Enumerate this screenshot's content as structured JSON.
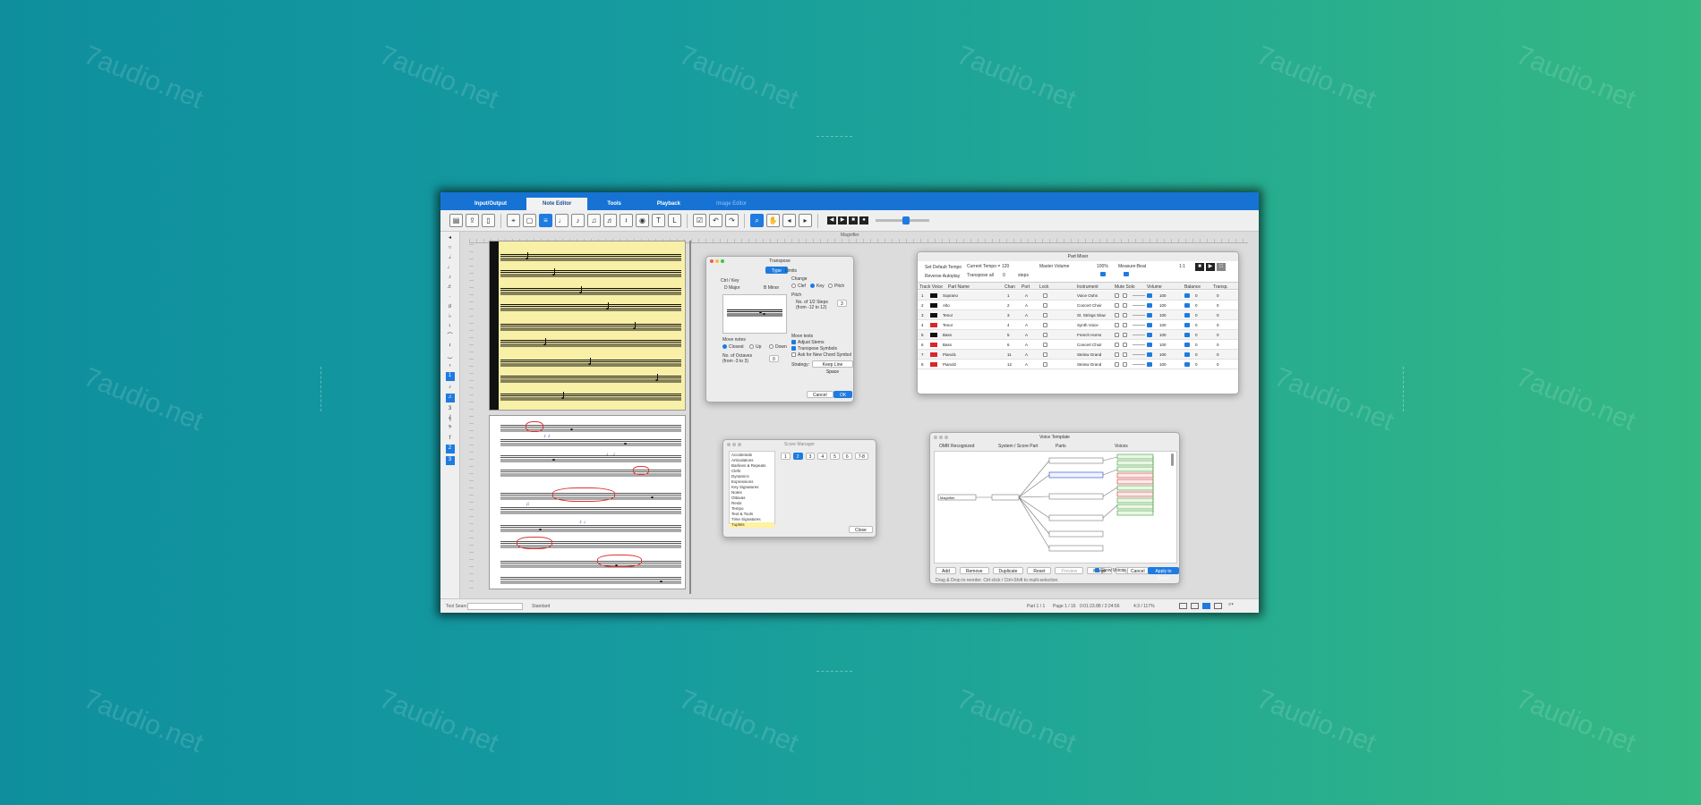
{
  "watermark": "7audio.net",
  "tabs": {
    "input_output": "Input/Output",
    "note_editor": "Note Editor",
    "tools": "Tools",
    "playback": "Playback",
    "image_editor": "Image Editor"
  },
  "workspace": {
    "magnifier_label": "Magnifier"
  },
  "transpose": {
    "title": "Transpose",
    "tab_type": "Type",
    "tab_limits": "Limits",
    "ctrl_key": "Ctrl / Key",
    "from_key": "D Major",
    "to_key": "B Minor",
    "change_label": "Change",
    "opt_clef": "Clef",
    "opt_key": "Key",
    "opt_pitch": "Pitch",
    "pitch_label": "Pitch",
    "steps_label": "No. of 1/2 Steps",
    "steps_range": "(from -12 to 12)",
    "steps_value": "3",
    "move_notes": "Move notes",
    "closest": "Closest",
    "up": "Up",
    "down": "Down",
    "octaves_label": "No. of Octaves",
    "octaves_range": "(from -3 to 3)",
    "octaves_value": "0",
    "more_texts": "Move texts",
    "adjust_stems": "Adjust Stems",
    "transpose_symbols": "Transpose Symbols",
    "ask_symbol": "Ask for New Chord Symbol",
    "strategy_label": "Strategy:",
    "strategy_value": "Keep Line Space",
    "cancel": "Cancel",
    "ok": "OK"
  },
  "mixer": {
    "title": "Part Mixer",
    "tempo_label": "Current Tempo =",
    "tempo_value": "120",
    "transpose_all": "Transpose all",
    "transpose_value": "0",
    "steps": "steps",
    "master_volume": "Master Volume",
    "master_value": "100%",
    "measure_beat": "Measure:Beat",
    "measure_value": "1:1",
    "set_tempo": "Set Default Tempo",
    "reverse_all": "Reverse Autoplay",
    "columns": [
      "Track Voice",
      "Part Name",
      "Chan",
      "Port",
      "Lock",
      "Instrument",
      "Mute Solo",
      "Volume",
      "Balance",
      "Transp."
    ],
    "rows": [
      {
        "num": "1",
        "name": "Soprano",
        "chan": "1",
        "port": "A",
        "instrument": "Voice Oohs",
        "volume": "100",
        "balance": "0",
        "transp": "0",
        "color": "#111111"
      },
      {
        "num": "2",
        "name": "Alto",
        "chan": "2",
        "port": "A",
        "instrument": "Concert Choir",
        "volume": "100",
        "balance": "0",
        "transp": "0",
        "color": "#111111"
      },
      {
        "num": "3",
        "name": "Tenor",
        "chan": "3",
        "port": "A",
        "instrument": "St. Strings Slow",
        "volume": "100",
        "balance": "0",
        "transp": "0",
        "color": "#111111"
      },
      {
        "num": "4",
        "name": "Tenor",
        "chan": "4",
        "port": "A",
        "instrument": "Synth Voice",
        "volume": "100",
        "balance": "0",
        "transp": "0",
        "color": "#d9262b"
      },
      {
        "num": "5",
        "name": "Bass",
        "chan": "5",
        "port": "A",
        "instrument": "French Horns",
        "volume": "100",
        "balance": "0",
        "transp": "0",
        "color": "#111111"
      },
      {
        "num": "6",
        "name": "Bass",
        "chan": "6",
        "port": "A",
        "instrument": "Concert Choir",
        "volume": "100",
        "balance": "0",
        "transp": "0",
        "color": "#d9262b"
      },
      {
        "num": "7",
        "name": "Pianol1",
        "chan": "11",
        "port": "A",
        "instrument": "Steinw Grand",
        "volume": "100",
        "balance": "0",
        "transp": "0",
        "color": "#d9262b"
      },
      {
        "num": "8",
        "name": "Pianol2",
        "chan": "12",
        "port": "A",
        "instrument": "Steinw Grand",
        "volume": "100",
        "balance": "0",
        "transp": "0",
        "color": "#d9262b"
      }
    ]
  },
  "score_manager": {
    "title": "Score Manager",
    "items": [
      "Accidentals",
      "Articulations",
      "Barlines & Repeats",
      "Clefs",
      "Dynamics",
      "Expressions",
      "Key Signatures",
      "Notes",
      "Ottavas",
      "Rests",
      "Tempo",
      "Text & Tools",
      "Time Signatures",
      "Tuplets"
    ],
    "tabs": [
      "1",
      "2",
      "3",
      "4",
      "5",
      "6",
      "7-8"
    ],
    "close": "Close"
  },
  "voice_template": {
    "title": "Voice Template",
    "col_source": "OMR Recognized",
    "col_system": "System / Score Part",
    "col_parts": "Parts",
    "col_voices": "Voices",
    "source_node": "Magnifier",
    "buttons": [
      "Add",
      "Remove",
      "Duplicate",
      "Reset",
      "Preview",
      "Merge",
      "Split"
    ],
    "hint": "Drag & Drop to reorder. Ctrl-click / Ctrl+Shift to multi-selection.",
    "cancel": "Cancel",
    "apply": "Apply to Score",
    "show_voices": "Show Voices"
  },
  "statusbar": {
    "search_label": "Tool Search",
    "mode": "Standard",
    "part": "Part 1 / 1",
    "page": "Page 1 / 16",
    "time": "0:01:23.88 / 2:24:56",
    "zoom": "4:3 / 117%"
  }
}
